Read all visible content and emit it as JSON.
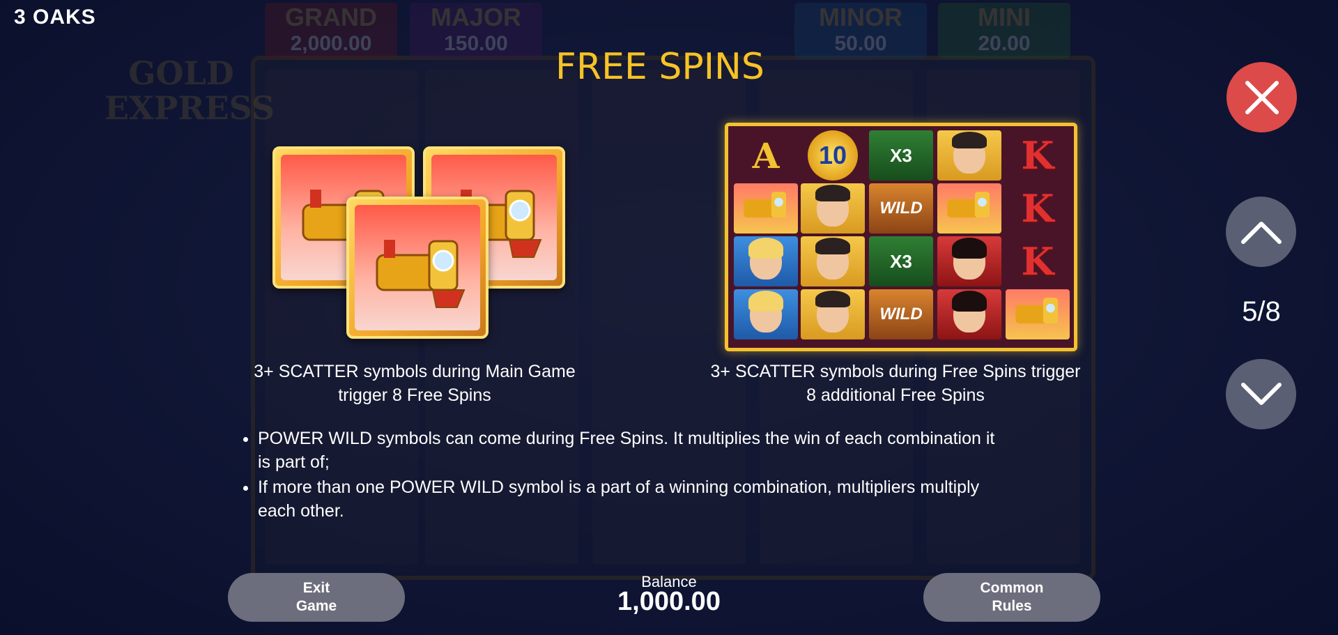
{
  "brand": "3 OAKS",
  "background": {
    "logo_text": "GOLD EXPRESS",
    "jackpots": [
      {
        "name": "GRAND",
        "value": "2,000.00",
        "color": "#8b1e1e"
      },
      {
        "name": "MAJOR",
        "value": "150.00",
        "color": "#5a1d6b"
      },
      {
        "name": "MINOR",
        "value": "50.00",
        "color": "#1c5a8a"
      },
      {
        "name": "MINI",
        "value": "20.00",
        "color": "#2a7a2a"
      }
    ]
  },
  "title": "FREE SPINS",
  "scatter_caption": "3+ SCATTER symbols during Main Game trigger 8 Free Spins",
  "grid_caption": "3+ SCATTER symbols during Free Spins trigger 8 additional Free Spins",
  "grid": {
    "coin_value": "10",
    "multiplier": "X3",
    "wild": "WILD",
    "letter_a": "A",
    "letter_k": "K"
  },
  "rules": [
    "POWER WILD symbols can come during Free Spins. It multiplies the win of each combination it is part of;",
    "If more than one POWER WILD symbol is a part of a winning combination, multipliers multiply each other."
  ],
  "nav": {
    "close_icon": "close-icon",
    "page_indicator": "5/8"
  },
  "footer": {
    "exit_label": "Exit\nGame",
    "balance_label": "Balance",
    "balance_value": "1,000.00",
    "common_label": "Common\nRules"
  },
  "colors": {
    "title": "#f6c326",
    "close_button": "#dc4a4a",
    "nav_button": "#5b5f73",
    "pill_button": "#6d6e7d"
  }
}
